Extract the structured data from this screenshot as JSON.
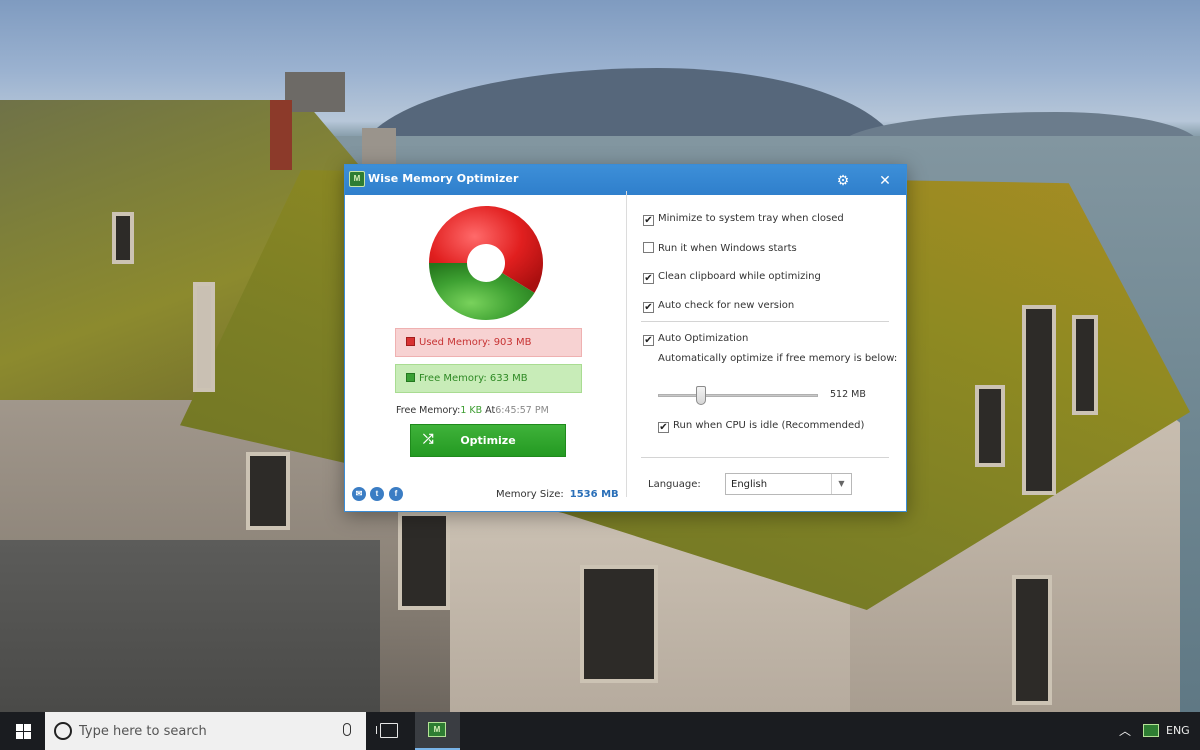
{
  "app": {
    "title": "Wise Memory Optimizer",
    "used_memory": "Used Memory: 903 MB",
    "free_memory": "Free Memory: 633 MB",
    "free_line_label": "Free Memory:",
    "free_line_amount": "1 KB",
    "free_line_at": " At",
    "free_line_time": "6:45:57 PM",
    "optimize_label": "Optimize",
    "memory_size_label": "Memory Size:",
    "memory_size_value": "1536 MB",
    "memory_used_fraction": 0.588,
    "colors": {
      "used": "#e11f1f",
      "free": "#3ea132",
      "titlebar": "#2f7fcc"
    }
  },
  "options": {
    "minimize_tray": {
      "label": "Minimize to system tray when closed",
      "checked": true
    },
    "run_startup": {
      "label": "Run it when Windows starts",
      "checked": false
    },
    "clean_clipboard": {
      "label": "Clean clipboard while optimizing",
      "checked": true
    },
    "auto_check": {
      "label": "Auto check for new version",
      "checked": true
    },
    "auto_optimization": {
      "label": "Auto Optimization",
      "checked": true
    },
    "auto_desc": "Automatically optimize if free memory is below:",
    "threshold_value": "512 MB",
    "threshold_fraction": 0.27,
    "cpu_idle": {
      "label": "Run when CPU is idle (Recommended)",
      "checked": true
    }
  },
  "language": {
    "label": "Language:",
    "selected": "English"
  },
  "icons": {
    "gear": "gear-icon",
    "close": "close-icon",
    "mail": "mail-icon",
    "twitter": "twitter-icon",
    "facebook": "facebook-icon",
    "shuffle": "shuffle-icon"
  },
  "taskbar": {
    "search_placeholder": "Type here to search",
    "tray_lang": "ENG"
  }
}
